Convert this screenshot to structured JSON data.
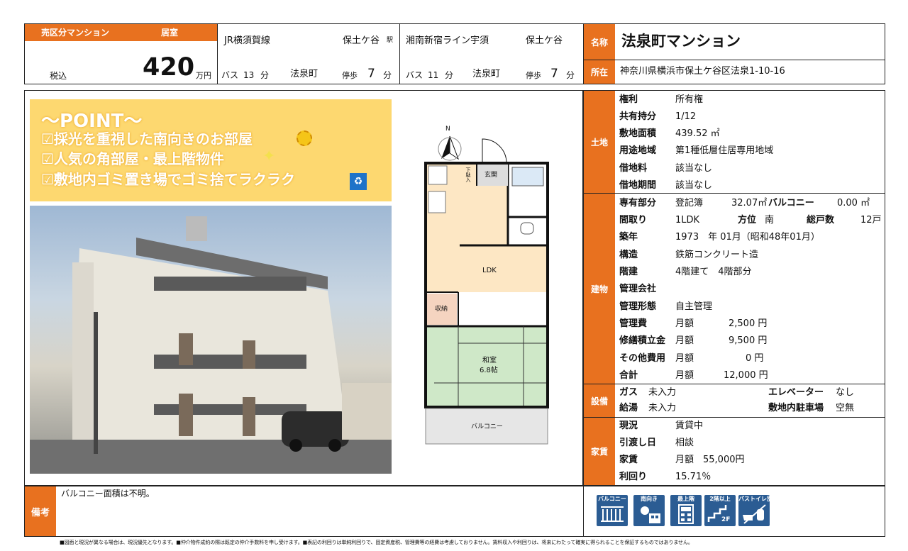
{
  "header": {
    "category_label": "売区分マンション",
    "unit_label": "居室",
    "tax_label": "税込",
    "price": "420",
    "price_unit": "万円",
    "access": [
      {
        "line": "JR横須賀線",
        "station": "保土ケ谷",
        "station_suffix": "駅",
        "bus_label": "バス",
        "bus_min": "13",
        "min_unit": "分",
        "stop": "法泉町",
        "walk_label": "停歩",
        "walk_min": "7"
      },
      {
        "line": "湘南新宿ライン宇須",
        "station": "保土ケ谷",
        "station_suffix": "",
        "bus_label": "バス",
        "bus_min": "11",
        "min_unit": "分",
        "stop": "法泉町",
        "walk_label": "停歩",
        "walk_min": "7"
      }
    ],
    "name_label": "名称",
    "name": "法泉町マンション",
    "address_label": "所在",
    "address": "神奈川県横浜市保土ケ谷区法泉1-10-16"
  },
  "point": {
    "title": "～POINT～",
    "items": [
      "☑採光を重視した南向きのお部屋",
      "☑人気の角部屋・最上階物件",
      "☑敷地内ゴミ置き場でゴミ捨てラクラク"
    ]
  },
  "floorplan": {
    "north": "N",
    "rooms": {
      "shoe": "下駄入",
      "entrance": "玄関",
      "ldk": "LDK",
      "storage": "収納",
      "washitsu": "和室",
      "washitsu_size": "6.8帖",
      "balcony": "バルコニー"
    }
  },
  "land": {
    "label": "土地",
    "rows": [
      {
        "k": "権利",
        "v": "所有権"
      },
      {
        "k": "共有持分",
        "v": "1/12"
      },
      {
        "k": "敷地面積",
        "v": "439.52 ㎡"
      },
      {
        "k": "用途地域",
        "v": "第1種低層住居専用地域"
      },
      {
        "k": "借地料",
        "v": "該当なし"
      },
      {
        "k": "借地期間",
        "v": "該当なし"
      }
    ]
  },
  "building": {
    "label": "建物",
    "exclusive_label": "専有部分",
    "exclusive_type": "登記簿",
    "exclusive_area": "32.07㎡",
    "balcony_label": "バルコニー",
    "balcony_area": "0.00 ㎡",
    "layout_label": "間取り",
    "layout": "1LDK",
    "direction_label": "方位",
    "direction": "南",
    "units_label": "総戸数",
    "units": "12戸",
    "built_label": "築年",
    "built": "1973　年 01月（昭和48年01月）",
    "structure_label": "構造",
    "structure": "鉄筋コンクリート造",
    "floors_label": "階建",
    "floors": "4階建て　4階部分",
    "mgmt_co_label": "管理会社",
    "mgmt_co": "",
    "mgmt_form_label": "管理形態",
    "mgmt_form": "自主管理",
    "fees": [
      {
        "k": "管理費",
        "period": "月額",
        "amount": "2,500 円"
      },
      {
        "k": "修繕積立金",
        "period": "月額",
        "amount": "9,500 円"
      },
      {
        "k": "その他費用",
        "period": "月額",
        "amount": "0 円"
      },
      {
        "k": "合計",
        "period": "月額",
        "amount": "12,000 円"
      }
    ]
  },
  "facilities": {
    "label": "設備",
    "gas_label": "ガス",
    "gas": "未入力",
    "elevator_label": "エレベーター",
    "elevator": "なし",
    "hotwater_label": "給湯",
    "hotwater": "未入力",
    "parking_label": "敷地内駐車場",
    "parking": "空無"
  },
  "rent": {
    "label": "家賃",
    "rows": [
      {
        "k": "現況",
        "v": "賃貸中"
      },
      {
        "k": "引渡し日",
        "v": "相談"
      },
      {
        "k": "家賃",
        "v": "月額　55,000円"
      },
      {
        "k": "利回り",
        "v": "15.71％"
      }
    ]
  },
  "remarks": {
    "label": "備考",
    "text": "バルコニー面積は不明。"
  },
  "badges": [
    "バルコニー",
    "南向き",
    "最上階",
    "2階以上",
    "バストイレ別"
  ],
  "badge_sub": [
    "",
    "",
    "",
    "2F",
    ""
  ],
  "footer": "■図面と現況が異なる場合は、現況優先となります。■仲介物件成約の際は既定の仲介手数料を申し受けます。■表記の利回りは単純利回りで、固定資産税、管理費等の経費は考慮しておりません。賃料収入や利回りは、将来にわたって確実に得られることを保証するものではありません。",
  "colors": {
    "accent": "#e8711f",
    "point_bg": "#fdd870",
    "badge": "#2b5c93"
  }
}
